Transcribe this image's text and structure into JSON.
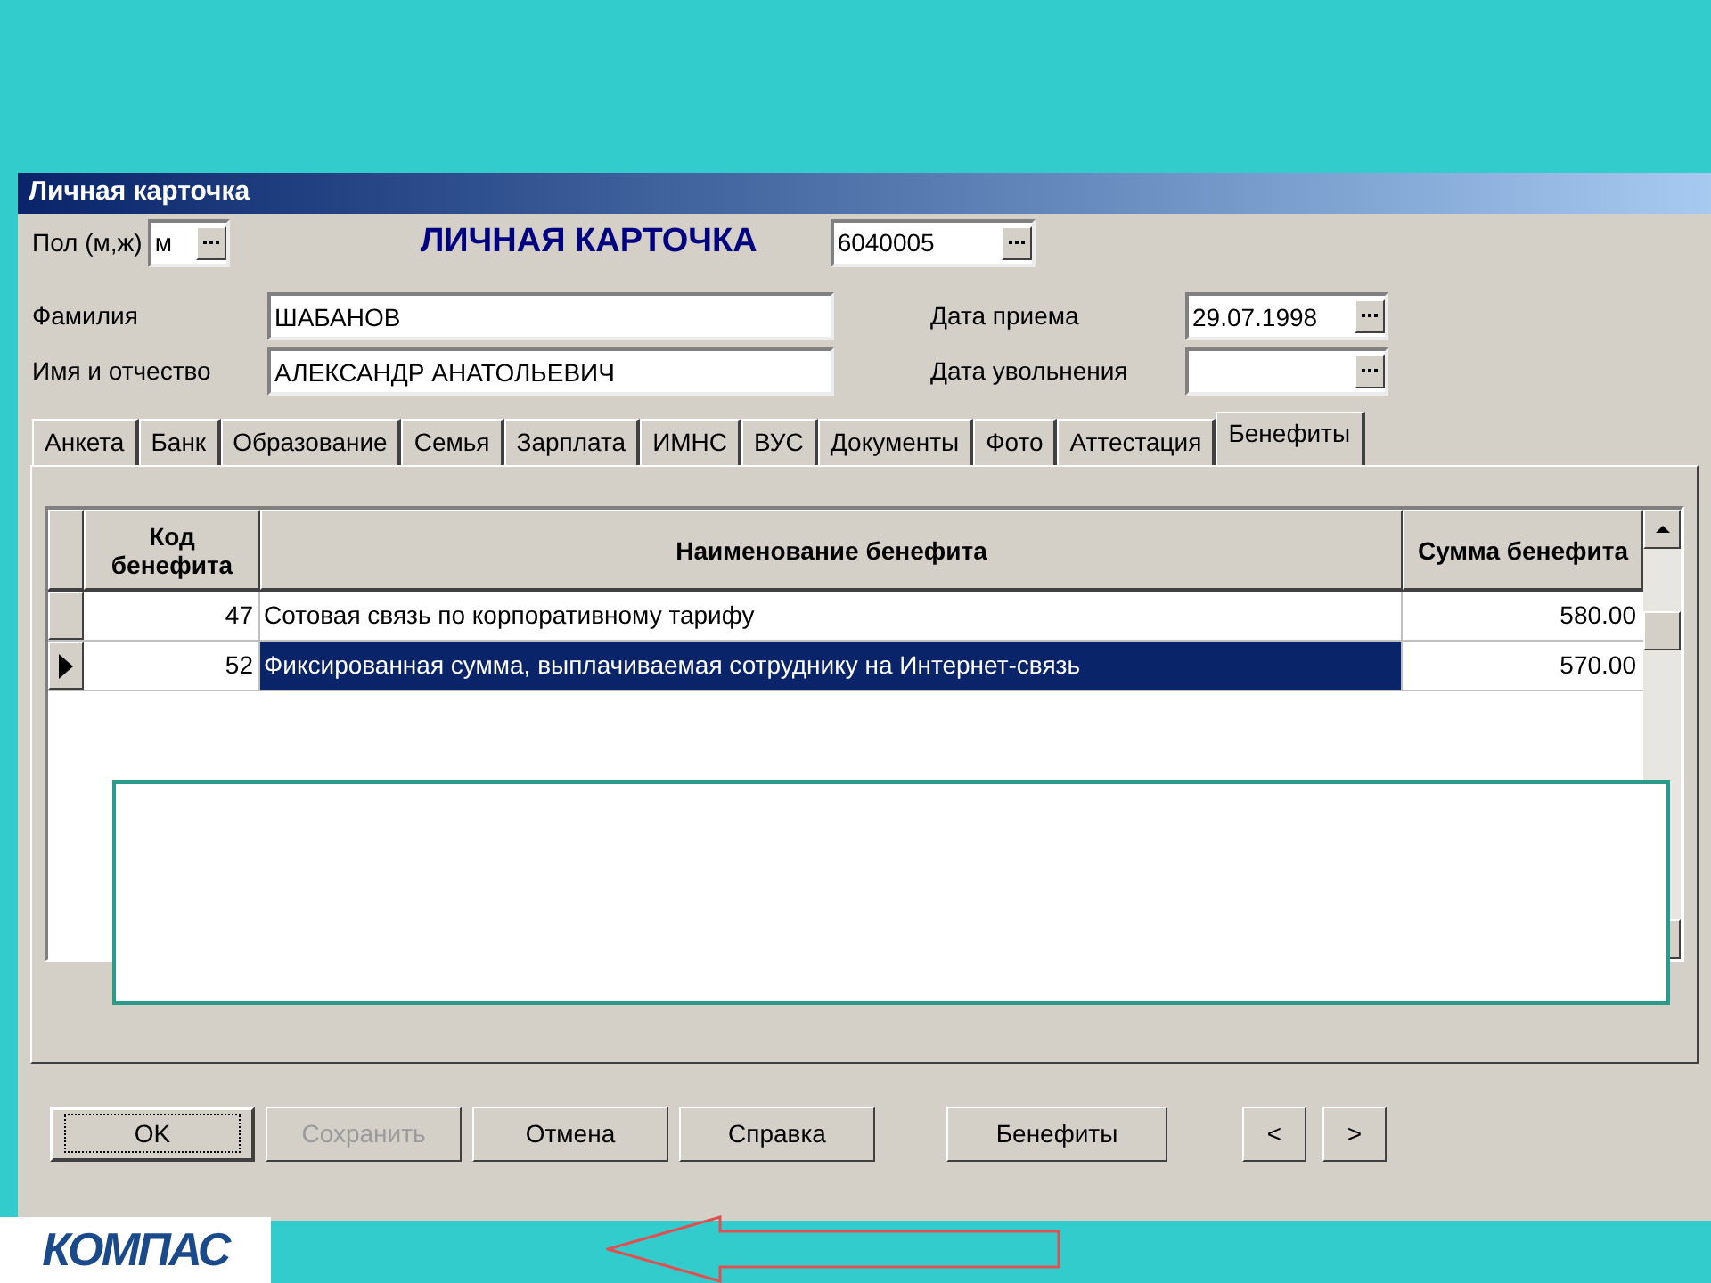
{
  "window": {
    "title": "Личная карточка"
  },
  "header": {
    "gender_label": "Пол (м,ж)",
    "gender_value": "м",
    "heading": "ЛИЧНАЯ КАРТОЧКА",
    "card_number": "6040005"
  },
  "fields": [
    {
      "label": "Фамилия",
      "value": "ШАБАНОВ"
    },
    {
      "label": "Имя и отчество",
      "value": "АЛЕКСАНДР АНАТОЛЬЕВИЧ"
    }
  ],
  "dates": [
    {
      "label": "Дата приема",
      "value": "29.07.1998"
    },
    {
      "label": "Дата увольнения"
    }
  ],
  "tabs": [
    {
      "label": "Анкета",
      "selected": false
    },
    {
      "label": "Банк",
      "selected": false
    },
    {
      "label": "Образование",
      "selected": false
    },
    {
      "label": "Семья",
      "selected": false
    },
    {
      "label": "Зарплата",
      "selected": false
    },
    {
      "label": "ИМНС",
      "selected": false
    },
    {
      "label": "ВУС",
      "selected": false
    },
    {
      "label": "Документы",
      "selected": false
    },
    {
      "label": "Фото",
      "selected": false
    },
    {
      "label": "Аттестация",
      "selected": false
    },
    {
      "label": "Бенефиты",
      "selected": true
    }
  ],
  "table": {
    "columns": [
      "Код бенефита",
      "Наименование бенефита",
      "Сумма бенефита"
    ],
    "rows": [
      {
        "code": "47",
        "name": "Сотовая связь по корпоративному тарифу",
        "sum": "580.00",
        "selected": false
      },
      {
        "code": "52",
        "name": "Фиксированная сумма, выплачиваемая сотруднику на Интернет-связь",
        "sum": "570.00",
        "selected": true
      }
    ]
  },
  "buttons": [
    {
      "label": "OK",
      "disabled": false,
      "default": true
    },
    {
      "label": "Сохранить",
      "disabled": true,
      "default": false
    },
    {
      "label": "Отмена",
      "disabled": false,
      "default": false
    },
    {
      "label": "Справка",
      "disabled": false,
      "default": false
    },
    {
      "label": "Бенефиты",
      "disabled": false,
      "default": false
    }
  ],
  "nav_buttons": [
    "<",
    ">"
  ],
  "logo": "КОМПАС"
}
